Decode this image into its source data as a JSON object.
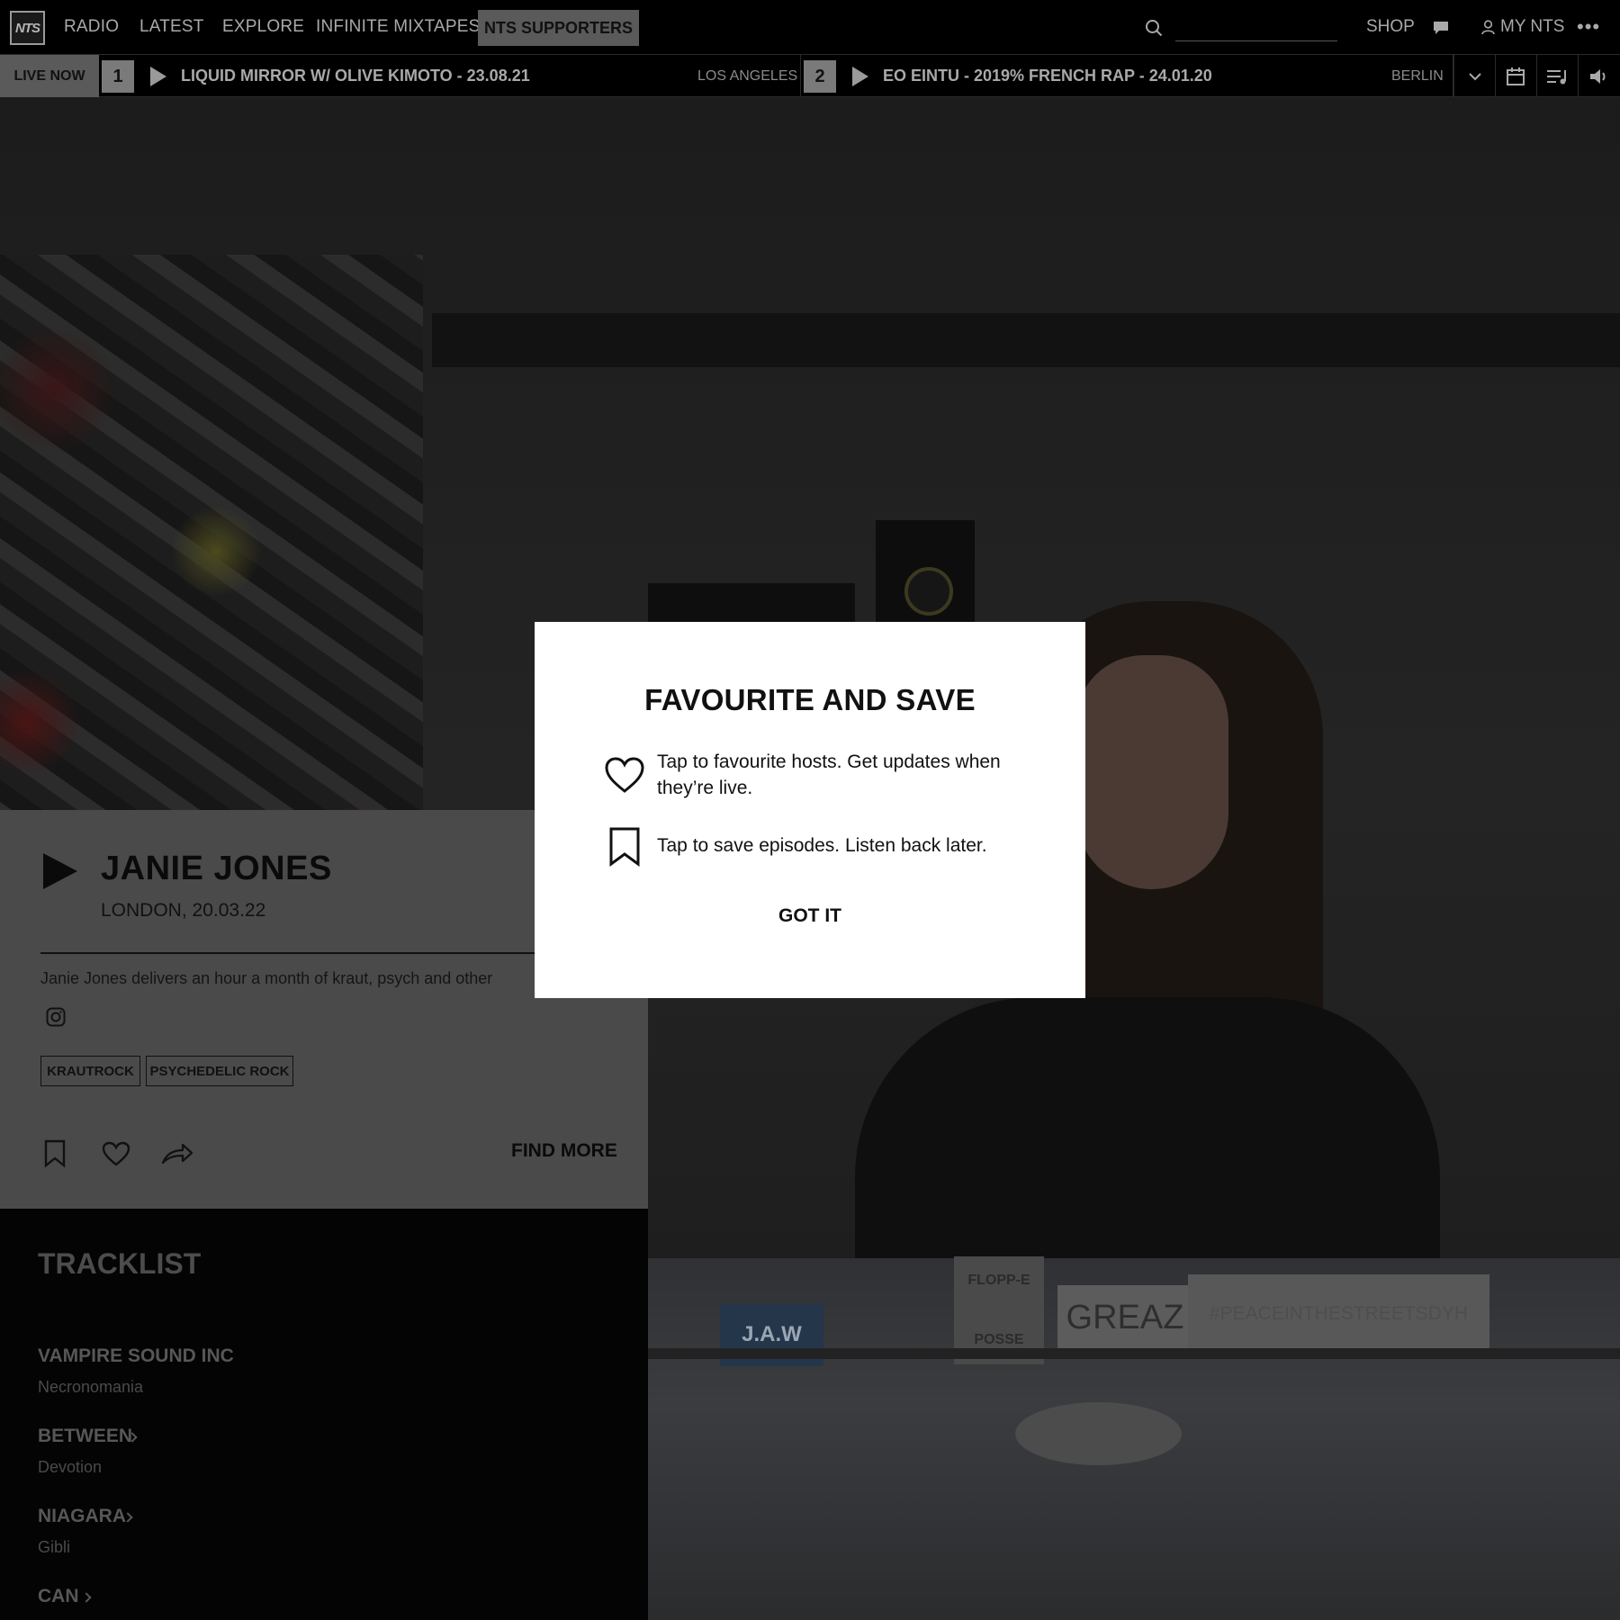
{
  "nav": {
    "logo": "NTS",
    "items": [
      "RADIO",
      "LATEST",
      "EXPLORE",
      "INFINITE MIXTAPES"
    ],
    "supporters": "NTS SUPPORTERS",
    "search_placeholder": "",
    "shop": "SHOP",
    "my_nts": "MY NTS"
  },
  "livebar": {
    "live_now": "LIVE NOW",
    "channels": [
      {
        "number": "1",
        "title": "LIQUID MIRROR W/ OLIVE KIMOTO - 23.08.21",
        "location": "LOS ANGELES"
      },
      {
        "number": "2",
        "title": "EO EINTU - 2019% FRENCH RAP - 24.01.20",
        "location": "BERLIN"
      }
    ]
  },
  "episode": {
    "title": "JANIE JONES",
    "meta": "LONDON, 20.03.22",
    "description": "Janie Jones delivers an hour a month of kraut, psych and other",
    "tags": [
      "KRAUTROCK",
      "PSYCHEDELIC ROCK"
    ],
    "find_more": "FIND MORE"
  },
  "tracklist": {
    "heading": "TRACKLIST",
    "tracks": [
      {
        "artist": "VAMPIRE SOUND INC",
        "title": "Necronomania"
      },
      {
        "artist": "BETWEEN",
        "title": "Devotion"
      },
      {
        "artist": "NIAGARA",
        "title": "Gibli"
      },
      {
        "artist": "CAN",
        "title": ""
      }
    ]
  },
  "modal": {
    "title": "FAVOURITE AND SAVE",
    "favourite_text": "Tap to favourite hosts. Get updates when they’re live.",
    "save_text": "Tap to save episodes. Listen back later.",
    "confirm": "GOT IT"
  },
  "photo_stickers": [
    "GREAZ",
    "#PEACEINTHESTREETSDYH",
    "J.A.W",
    "FLOPP-E",
    "POSSE"
  ]
}
